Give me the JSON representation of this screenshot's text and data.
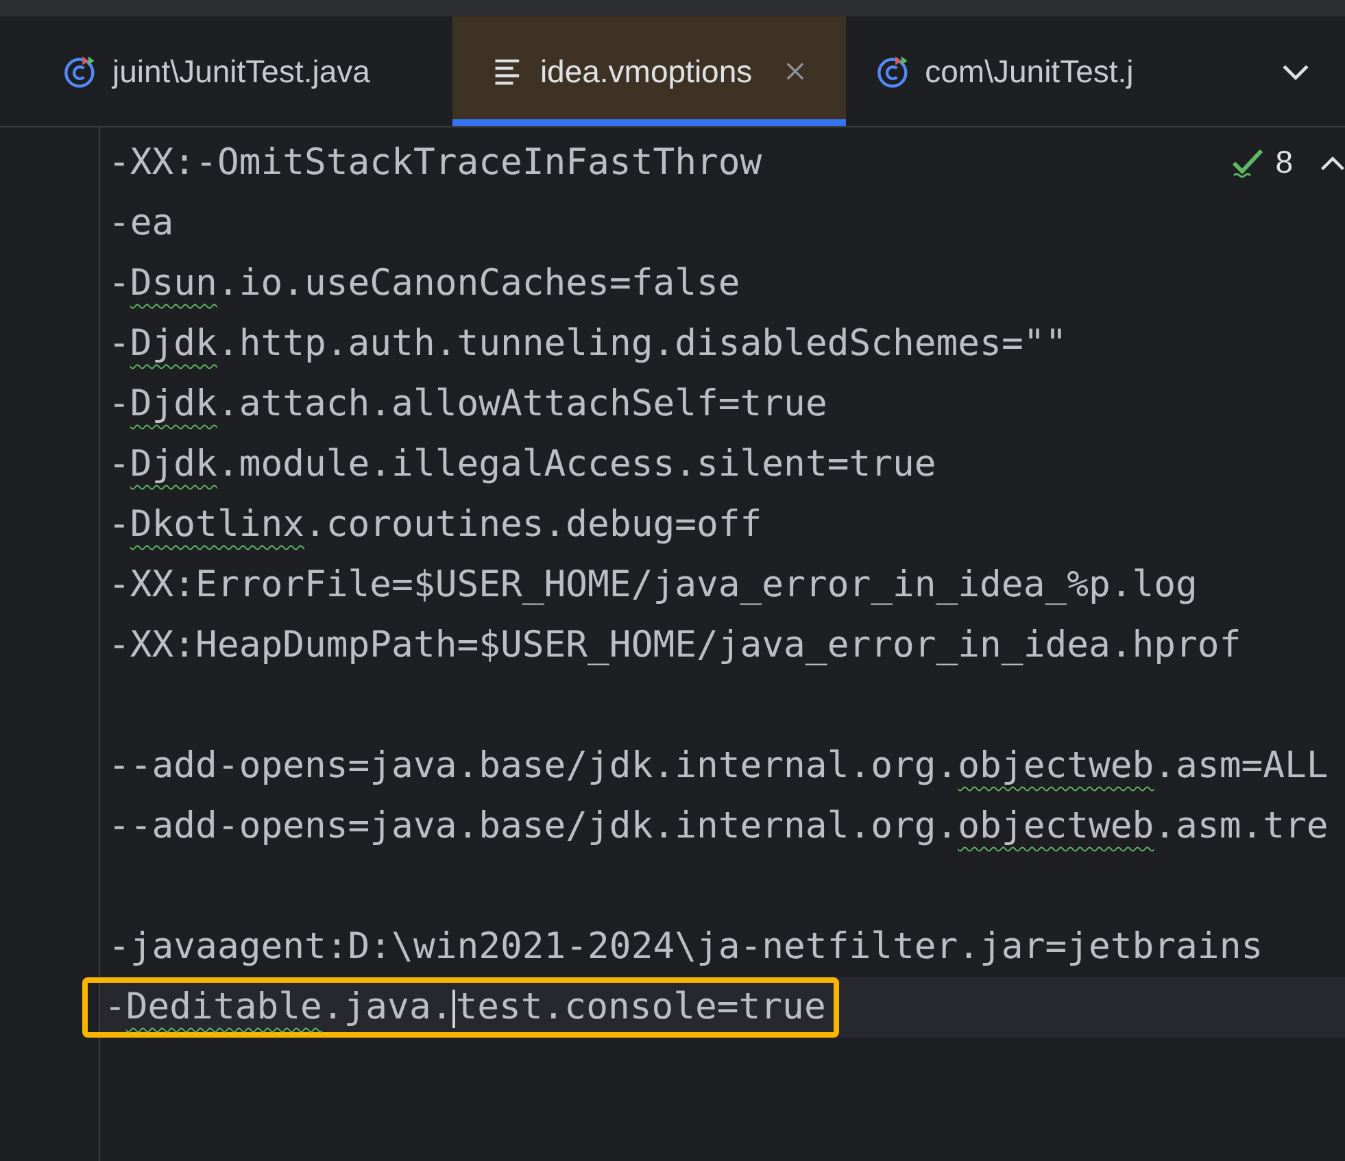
{
  "tabs": [
    {
      "label": "juint\\JunitTest.java",
      "kind": "java",
      "selected": false,
      "closable": false
    },
    {
      "label": "idea.vmoptions",
      "kind": "text",
      "selected": true,
      "closable": true
    },
    {
      "label": "com\\JunitTest.j",
      "kind": "java",
      "selected": false,
      "closable": false
    }
  ],
  "inspection": {
    "count": "8"
  },
  "lines": [
    {
      "kind": "code",
      "segments": [
        {
          "text": "-XX:-OmitStackTraceInFastThrow",
          "typo": false
        }
      ]
    },
    {
      "kind": "code",
      "segments": [
        {
          "text": "-ea",
          "typo": false
        }
      ]
    },
    {
      "kind": "code",
      "segments": [
        {
          "text": "-",
          "typo": false
        },
        {
          "text": "Dsun",
          "typo": true
        },
        {
          "text": ".io.useCanonCaches=false",
          "typo": false
        }
      ]
    },
    {
      "kind": "code",
      "segments": [
        {
          "text": "-",
          "typo": false
        },
        {
          "text": "Djdk",
          "typo": true
        },
        {
          "text": ".http.auth.tunneling.disabledSchemes=\"\"",
          "typo": false
        }
      ]
    },
    {
      "kind": "code",
      "segments": [
        {
          "text": "-",
          "typo": false
        },
        {
          "text": "Djdk",
          "typo": true
        },
        {
          "text": ".attach.allowAttachSelf=true",
          "typo": false
        }
      ]
    },
    {
      "kind": "code",
      "segments": [
        {
          "text": "-",
          "typo": false
        },
        {
          "text": "Djdk",
          "typo": true
        },
        {
          "text": ".module.illegalAccess.silent=true",
          "typo": false
        }
      ]
    },
    {
      "kind": "code",
      "segments": [
        {
          "text": "-",
          "typo": false
        },
        {
          "text": "Dkotlinx",
          "typo": true
        },
        {
          "text": ".coroutines.debug=off",
          "typo": false
        }
      ]
    },
    {
      "kind": "code",
      "segments": [
        {
          "text": "-XX:ErrorFile=$USER_HOME/java_error_in_idea_%p.log",
          "typo": false
        }
      ]
    },
    {
      "kind": "code",
      "segments": [
        {
          "text": "-XX:HeapDumpPath=$USER_HOME/java_error_in_idea.hprof",
          "typo": false
        }
      ]
    },
    {
      "kind": "blank"
    },
    {
      "kind": "code",
      "segments": [
        {
          "text": "--add-opens=java.base/jdk.internal.org.",
          "typo": false
        },
        {
          "text": "objectweb",
          "typo": true
        },
        {
          "text": ".asm=ALL",
          "typo": false
        }
      ]
    },
    {
      "kind": "code",
      "segments": [
        {
          "text": "--add-opens=java.base/jdk.internal.org.",
          "typo": false
        },
        {
          "text": "objectweb",
          "typo": true
        },
        {
          "text": ".asm.tre",
          "typo": false
        }
      ]
    },
    {
      "kind": "blank"
    },
    {
      "kind": "code",
      "segments": [
        {
          "text": "-javaagent:D:\\win2021-2024\\ja-netfilter.jar=jetbrains",
          "typo": false
        }
      ]
    },
    {
      "kind": "code",
      "current": true,
      "highlighted": true,
      "segments": [
        {
          "text": "-",
          "typo": false
        },
        {
          "text": "Deditable",
          "typo": true
        },
        {
          "text": ".java.",
          "typo": false
        },
        {
          "text": "test.console=true",
          "typo": false,
          "caret_before": true
        }
      ]
    }
  ]
}
